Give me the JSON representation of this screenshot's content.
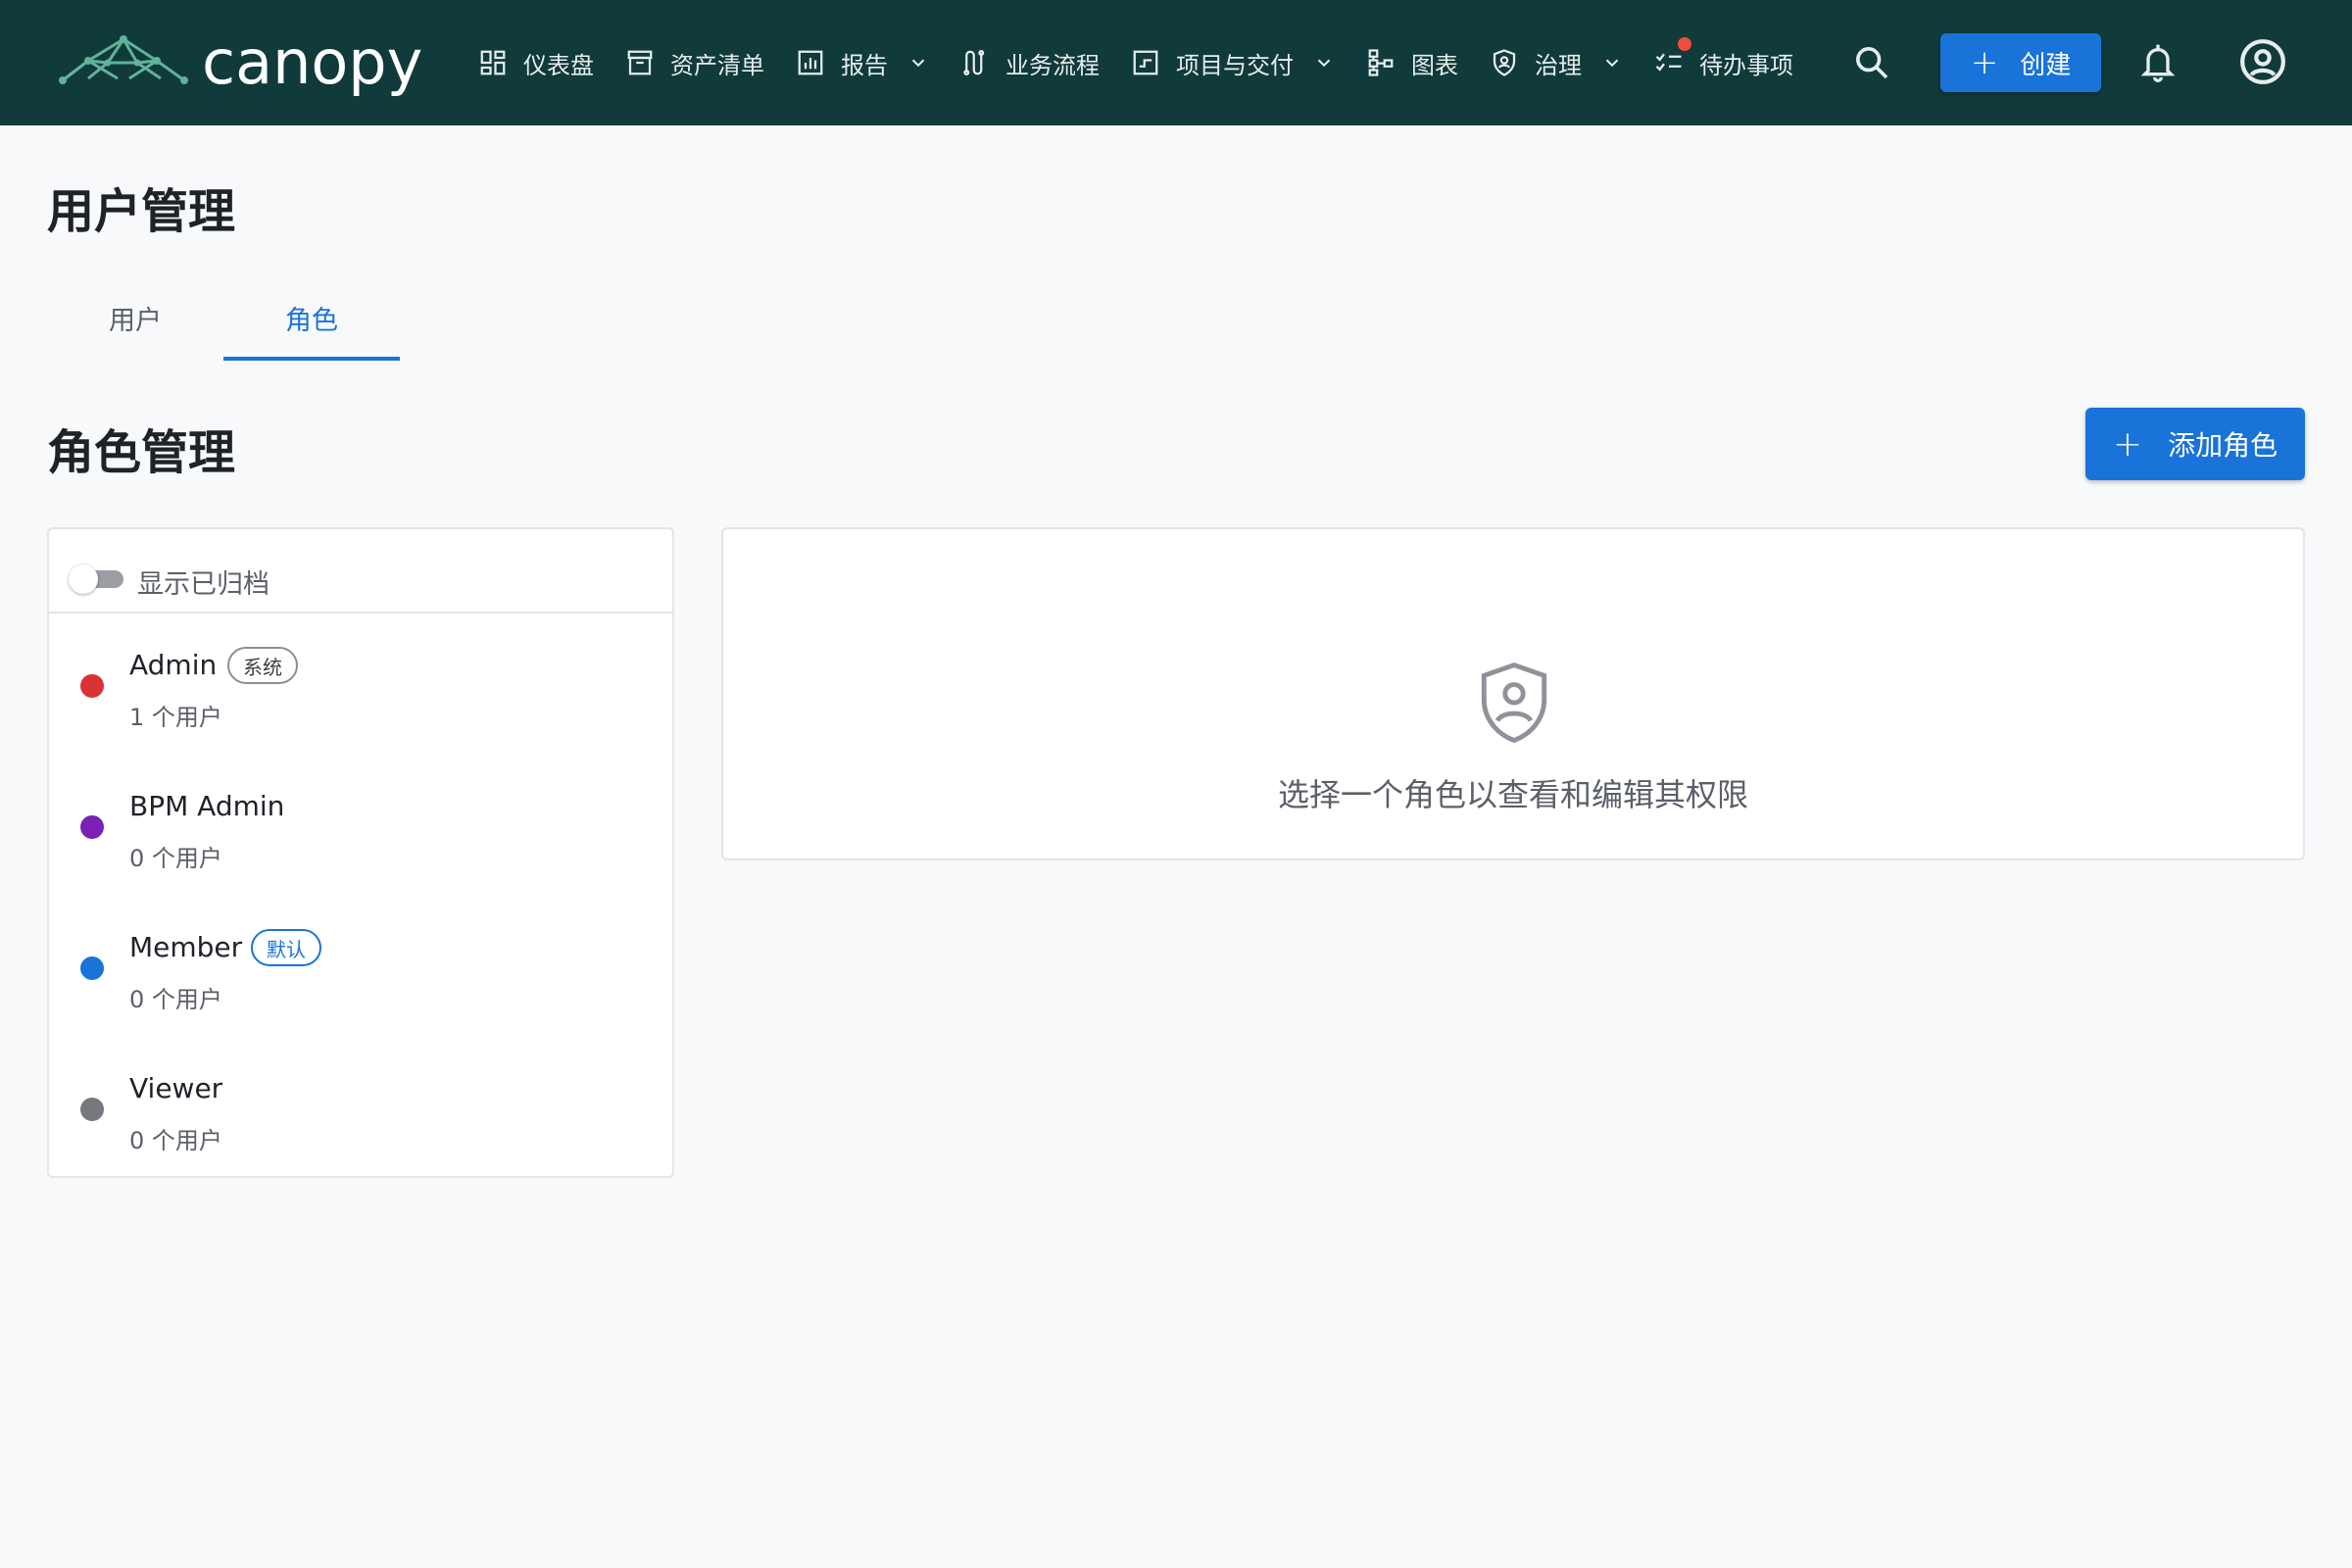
{
  "app": {
    "logo_text": "canopy"
  },
  "nav": {
    "items": [
      {
        "label": "仪表盘",
        "icon": "dashboard-icon"
      },
      {
        "label": "资产清单",
        "icon": "archive-icon"
      },
      {
        "label": "报告",
        "icon": "report-icon",
        "dropdown": true
      },
      {
        "label": "业务流程",
        "icon": "workflow-icon"
      },
      {
        "label": "项目与交付",
        "icon": "project-icon",
        "dropdown": true
      },
      {
        "label": "图表",
        "icon": "diagram-icon"
      },
      {
        "label": "治理",
        "icon": "shield-icon",
        "dropdown": true
      },
      {
        "label": "待办事项",
        "icon": "checklist-icon",
        "notification": true
      }
    ],
    "create_label": "创建"
  },
  "page": {
    "title": "用户管理",
    "tabs": [
      {
        "label": "用户",
        "active": false
      },
      {
        "label": "角色",
        "active": true
      }
    ],
    "section_title": "角色管理",
    "add_role_label": "添加角色"
  },
  "roles": {
    "show_archived_label": "显示已归档",
    "show_archived": false,
    "items": [
      {
        "name": "Admin",
        "badge": "系统",
        "badge_style": "gray",
        "count": "1 个用户",
        "color": "#d93232"
      },
      {
        "name": "BPM Admin",
        "badge": "",
        "badge_style": "",
        "count": "0 个用户",
        "color": "#7b22b5"
      },
      {
        "name": "Member",
        "badge": "默认",
        "badge_style": "blue",
        "count": "0 个用户",
        "color": "#1a73d9"
      },
      {
        "name": "Viewer",
        "badge": "",
        "badge_style": "",
        "count": "0 个用户",
        "color": "#75787c"
      }
    ]
  },
  "detail": {
    "empty_message": "选择一个角色以查看和编辑其权限",
    "empty_icon": "shield-user-icon"
  },
  "colors": {
    "topbar": "#113a3a",
    "accent": "#1a73d9"
  }
}
